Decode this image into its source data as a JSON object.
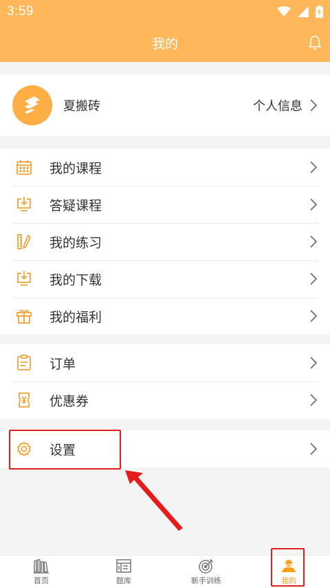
{
  "status": {
    "time": "3:59"
  },
  "header": {
    "title": "我的"
  },
  "profile": {
    "name": "夏搬砖",
    "info_label": "个人信息"
  },
  "menu_group1": [
    {
      "label": "我的课程",
      "icon": "calendar-icon"
    },
    {
      "label": "答疑课程",
      "icon": "download-monitor-icon"
    },
    {
      "label": "我的练习",
      "icon": "ruler-pencil-icon"
    },
    {
      "label": "我的下载",
      "icon": "download-monitor-icon"
    },
    {
      "label": "我的福利",
      "icon": "gift-icon"
    }
  ],
  "menu_group2": [
    {
      "label": "订单",
      "icon": "clipboard-icon"
    },
    {
      "label": "优惠券",
      "icon": "coupon-icon"
    }
  ],
  "menu_group3": [
    {
      "label": "设置",
      "icon": "gear-icon"
    }
  ],
  "tabs": [
    {
      "label": "首页",
      "icon": "home-books-icon",
      "active": false
    },
    {
      "label": "题库",
      "icon": "question-bank-icon",
      "active": false
    },
    {
      "label": "新手训练",
      "icon": "target-icon",
      "active": false
    },
    {
      "label": "我的",
      "icon": "user-icon",
      "active": true
    }
  ],
  "colors": {
    "accent": "#ffb759",
    "active_tab": "#ff9d1f",
    "highlight": "#e51c1c",
    "icon": "#f0a43a"
  }
}
